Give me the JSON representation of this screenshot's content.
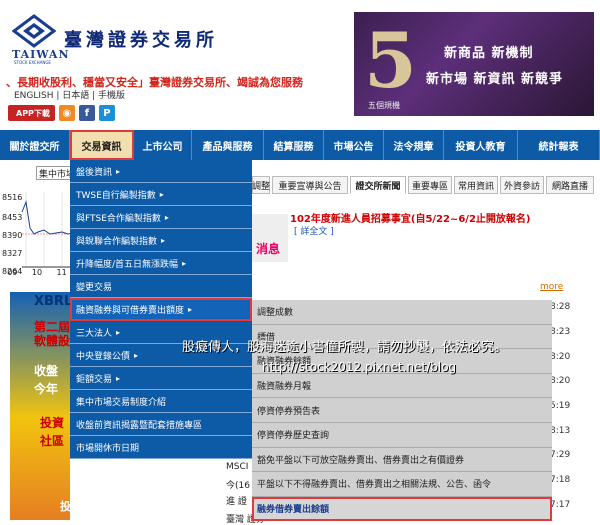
{
  "header": {
    "logo_name": "TAIWAN",
    "logo_sub": "STOCK EXCHANGE",
    "company": "臺灣證券交易所",
    "slogan": "、長期收股利、穩當又安全」臺灣證券交易所、竭誠為您服務",
    "langs": "ENGLISH | 日本語 | 手機版",
    "app_label": "APP下載"
  },
  "ad": {
    "big": "5",
    "sub": "五個規機",
    "line1": "新商品 新機制",
    "line2": "新市場 新資訊 新競爭"
  },
  "nav": [
    "關於證交所",
    "交易資訊",
    "上市公司",
    "產品與服務",
    "結算服務",
    "市場公告",
    "法令規章",
    "投資人教育",
    "統計報表"
  ],
  "market": {
    "label": "集中市場",
    "y_ticks": [
      "8516",
      "8453",
      "8390",
      "8327",
      "8264"
    ],
    "x_ticks": [
      "09",
      "10",
      "11"
    ]
  },
  "tabs": [
    "調整",
    "重要宣導與公告",
    "證交所新聞",
    "重要專區",
    "常用資訊",
    "外資參訪",
    "網路直播"
  ],
  "news": {
    "headline": "102年度新進人員招募事宜(自5/22~6/2止開放報名)",
    "link": "[ 詳全文 ]",
    "img_text": "消息"
  },
  "more": "more",
  "times": [
    "8:28",
    "8:23",
    "8:20",
    "8:20",
    "5:19",
    "8:13",
    "7:29",
    "7:18",
    "7:17"
  ],
  "left": {
    "xbrl": "XBRL",
    "t1": "第二屆",
    "t2": "軟體設",
    "t3": "收盤",
    "t4": "今年",
    "t5": "投資",
    "t6": "社區",
    "t7": "投資人園遊室"
  },
  "menu": [
    {
      "label": "盤後資訊",
      "arrow": "▸"
    },
    {
      "label": "TWSE自行編製指數",
      "arrow": "▸"
    },
    {
      "label": "與FTSE合作編製指數",
      "arrow": "▸"
    },
    {
      "label": "與銳聯合作編製指數",
      "arrow": "▸"
    },
    {
      "label": "升降幅度/首五日無漲跌幅",
      "arrow": "▸"
    },
    {
      "label": "變更交易",
      "arrow": ""
    },
    {
      "label": "融資融券與可借券賣出額度",
      "arrow": "▸"
    },
    {
      "label": "三大法人",
      "arrow": "▸"
    },
    {
      "label": "中央登錄公債",
      "arrow": "▸"
    },
    {
      "label": "鉅額交易",
      "arrow": "▸"
    },
    {
      "label": "集中市場交易制度介紹",
      "arrow": ""
    },
    {
      "label": "收盤前資訊揭露暨配套措施專區",
      "arrow": ""
    },
    {
      "label": "市場開休市日期",
      "arrow": ""
    }
  ],
  "submenu": [
    "調整成數",
    "標借",
    "融資融券餘額",
    "融資融券月報",
    "停資停券預告表",
    "停資停券歷史查詢",
    "豁免平盤以下可放空融券賣出、借券賣出之有價證券",
    "平盤以下不得融券賣出、借券賣出之相關法規、公告、函令",
    "融券借券賣出餘額"
  ],
  "bottom": {
    "k1": "MSCI",
    "k2": "今(16",
    "k3": "進 證",
    "k4": "臺灣 證券"
  },
  "watermark": {
    "line1": "股癡傳人，股海迷途小書僮所製，請勿抄襲，依法必究。",
    "line2": "http://stock2012.pixnet.net/blog"
  },
  "colors": {
    "nav_bg": "#0d5aa7",
    "highlight": "#e23a3a",
    "submenu_bg": "#d0d0d0",
    "slogan": "#d0261c"
  }
}
